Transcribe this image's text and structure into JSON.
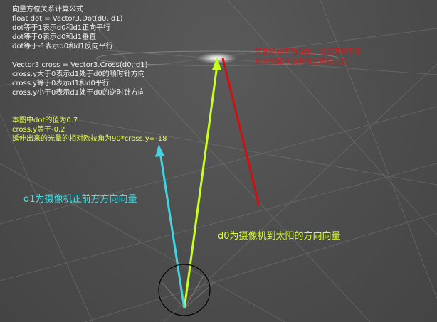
{
  "formula_lines": [
    "向量方位关系计算公式",
    "float dot = Vector3.Dot(d0, d1)",
    "dot等于1表示d0和d1正向平行",
    "dot等于0表示d0和d1垂直",
    "dot等于-1表示d0和d1反向平行"
  ],
  "cross_lines": [
    "Vector3 cross = Vector3.Cross(d0, d1)",
    "cross.y大于0表示d1处于d0的顺时针方向",
    "cross.y等于0表示d1和d0平行",
    "cross.y小于0表示d1处于d0的逆时针方向"
  ],
  "value_lines": [
    "本图中dot的值为0.7",
    "cross.y等于-0.2",
    "延伸出来的光晕的相对欧拉角为90*cross.y=-18"
  ],
  "red_note_lines": [
    "红色线段不为向量，这里用来示意",
    "从太阳延伸出来的光晕的方位"
  ],
  "d1_label": "d1为摄像机正前方方向向量",
  "d0_label": "d0为摄像机到太阳的方向向量",
  "colors": {
    "d1_vector": "#3fd6e0",
    "d0_vector": "#c8ff1e",
    "glow_segment": "#d01010",
    "formula_text": "#f2f2f2",
    "value_text": "#e6ff4a"
  }
}
